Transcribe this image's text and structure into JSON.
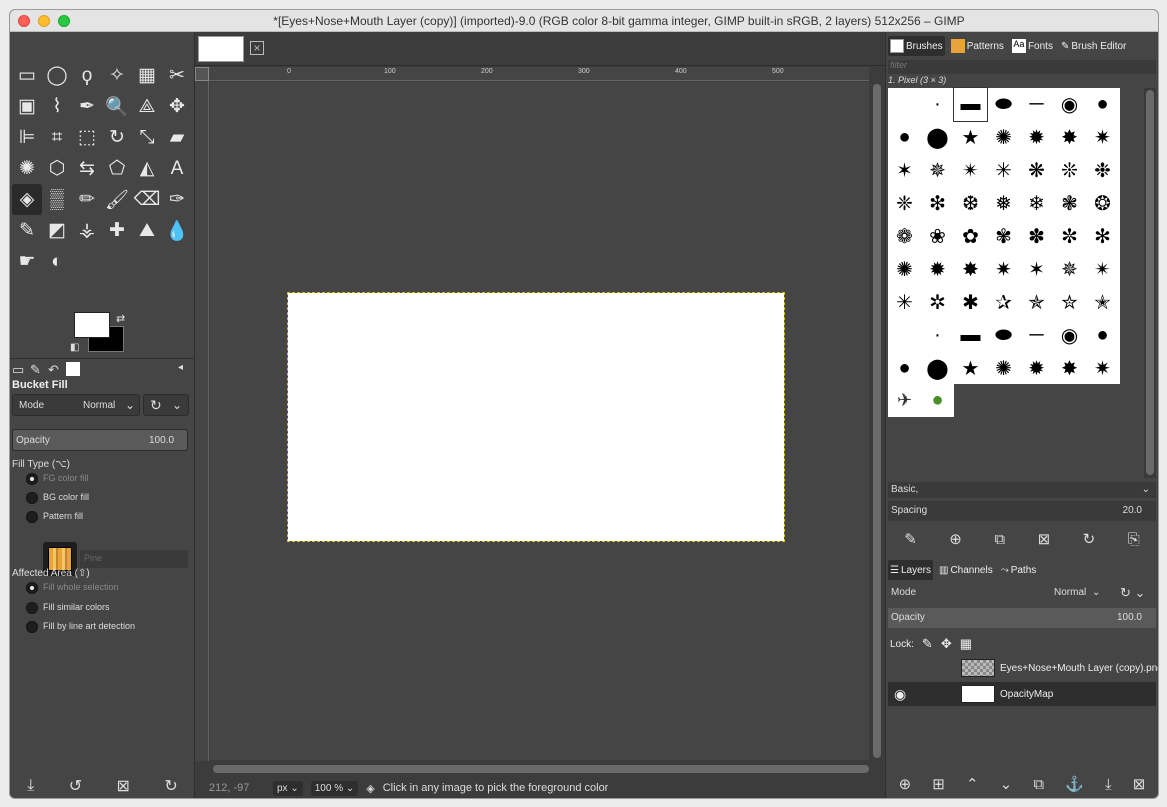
{
  "window": {
    "title": "*[Eyes+Nose+Mouth Layer (copy)] (imported)-9.0 (RGB color 8-bit gamma integer, GIMP built-in sRGB, 2 layers) 512x256 – GIMP"
  },
  "toolbox": {
    "tools": [
      {
        "name": "rect-select-icon",
        "glyph": "▭"
      },
      {
        "name": "ellipse-select-icon",
        "glyph": "◯"
      },
      {
        "name": "free-select-icon",
        "glyph": "ϙ"
      },
      {
        "name": "fuzzy-select-icon",
        "glyph": "✧"
      },
      {
        "name": "select-by-color-icon",
        "glyph": "▦"
      },
      {
        "name": "crop-icon",
        "glyph": "✂"
      },
      {
        "name": "foreground-select-icon",
        "glyph": "▣"
      },
      {
        "name": "paths-icon",
        "glyph": "⌇"
      },
      {
        "name": "color-picker-icon",
        "glyph": "✒"
      },
      {
        "name": "zoom-icon",
        "glyph": "🔍"
      },
      {
        "name": "measure-icon",
        "glyph": "⟁"
      },
      {
        "name": "move-icon",
        "glyph": "✥"
      },
      {
        "name": "align-icon",
        "glyph": "⊫"
      },
      {
        "name": "crop-tool-icon",
        "glyph": "⌗"
      },
      {
        "name": "unified-transform-icon",
        "glyph": "⬚"
      },
      {
        "name": "rotate-icon",
        "glyph": "↻"
      },
      {
        "name": "scale-icon",
        "glyph": "⤡"
      },
      {
        "name": "shear-icon",
        "glyph": "▰"
      },
      {
        "name": "warp-icon",
        "glyph": "✺"
      },
      {
        "name": "perspective-icon",
        "glyph": "⬡"
      },
      {
        "name": "flip-icon",
        "glyph": "⇆"
      },
      {
        "name": "cage-icon",
        "glyph": "⬠"
      },
      {
        "name": "warp-transform-icon",
        "glyph": "◭"
      },
      {
        "name": "text-icon",
        "glyph": "A"
      },
      {
        "name": "bucket-fill-icon",
        "glyph": "◈"
      },
      {
        "name": "gradient-icon",
        "glyph": "▒"
      },
      {
        "name": "pencil-icon",
        "glyph": "✏"
      },
      {
        "name": "paintbrush-icon",
        "glyph": "🖌"
      },
      {
        "name": "eraser-icon",
        "glyph": "⌫"
      },
      {
        "name": "airbrush-icon",
        "glyph": "✑"
      },
      {
        "name": "ink-icon",
        "glyph": "✎"
      },
      {
        "name": "mypaint-brush-icon",
        "glyph": "◩"
      },
      {
        "name": "clone-icon",
        "glyph": "⚶"
      },
      {
        "name": "heal-icon",
        "glyph": "✚"
      },
      {
        "name": "perspective-clone-icon",
        "glyph": "⛰"
      },
      {
        "name": "blur-icon",
        "glyph": "💧"
      },
      {
        "name": "smudge-icon",
        "glyph": "☛"
      },
      {
        "name": "dodge-burn-icon",
        "glyph": "◐"
      }
    ],
    "active_tool_index": 24,
    "tool_options_title": "Bucket Fill",
    "mode_label": "Mode",
    "mode_value": "Normal",
    "opacity_label": "Opacity",
    "opacity_value": "100.0",
    "fill_type_label": "Fill Type  (⌥)",
    "fill_types": [
      "FG color fill",
      "BG color fill",
      "Pattern fill"
    ],
    "fill_type_selected": 0,
    "pattern_name": "Pine",
    "affected_area_label": "Affected Area  (⇧)",
    "affected_areas": [
      "Fill whole selection",
      "Fill similar colors",
      "Fill by line art detection"
    ],
    "affected_area_selected": 0
  },
  "image": {
    "ruler_labels": [
      "0",
      "100",
      "200",
      "300",
      "400",
      "500"
    ],
    "coords": "212, -97",
    "unit": "px",
    "zoom": "100 %",
    "status_message": "Click in any image to pick the foreground color"
  },
  "dock": {
    "tabs": [
      "Brushes",
      "Patterns",
      "Fonts",
      "Brush Editor"
    ],
    "filter_placeholder": "filter",
    "brush_selected": "1. Pixel (3 × 3)",
    "preset": "Basic,",
    "spacing_label": "Spacing",
    "spacing_value": "20.0",
    "layer_tabs": [
      "Layers",
      "Channels",
      "Paths"
    ],
    "layer_mode_label": "Mode",
    "layer_mode_value": "Normal",
    "layer_opacity_label": "Opacity",
    "layer_opacity_value": "100.0",
    "lock_label": "Lock:",
    "layers": [
      {
        "name": "Eyes+Nose+Mouth Layer (copy).png",
        "thumb": "checker",
        "visible": false
      },
      {
        "name": "OpacityMap",
        "thumb": "white",
        "visible": true
      }
    ]
  }
}
